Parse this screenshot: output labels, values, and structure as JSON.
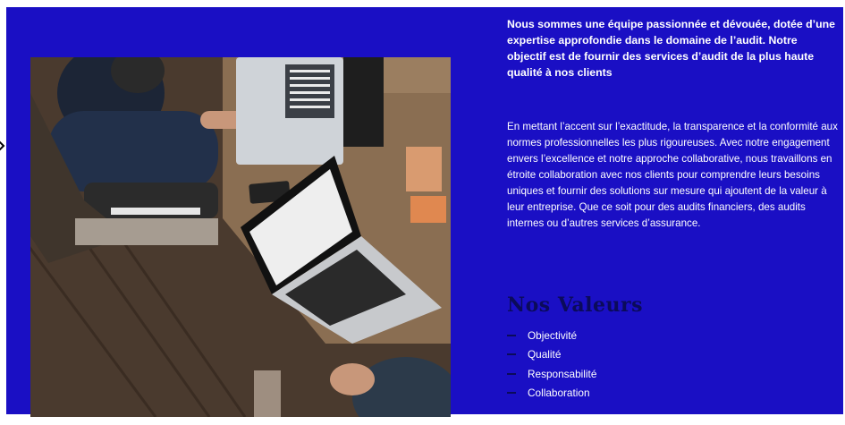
{
  "intro": "Nous sommes une équipe passionnée et dévouée, dotée d’une expertise approfondie dans le domaine de l’audit. Notre objectif est de fournir des services d’audit de la plus haute qualité à nos clients",
  "body": "En mettant l’accent sur l’exactitude, la transparence et la conformité aux normes professionnelles les plus rigoureuses. Avec notre engagement envers l’excellence et notre approche collaborative, nous travaillons en étroite collaboration avec nos clients pour comprendre leurs besoins uniques et fournir des solutions sur mesure qui ajoutent de la valeur à leur entreprise. Que ce soit pour des audits financiers, des audits internes ou d’autres services d’assurance.",
  "values": {
    "title": "Nos Valeurs",
    "items": [
      "Objectivité",
      "Qualité",
      "Responsabilité",
      "Collaboration"
    ]
  },
  "colors": {
    "background": "#1a0fc4",
    "accent_dark": "#0b0b5a",
    "text": "#ffffff"
  }
}
